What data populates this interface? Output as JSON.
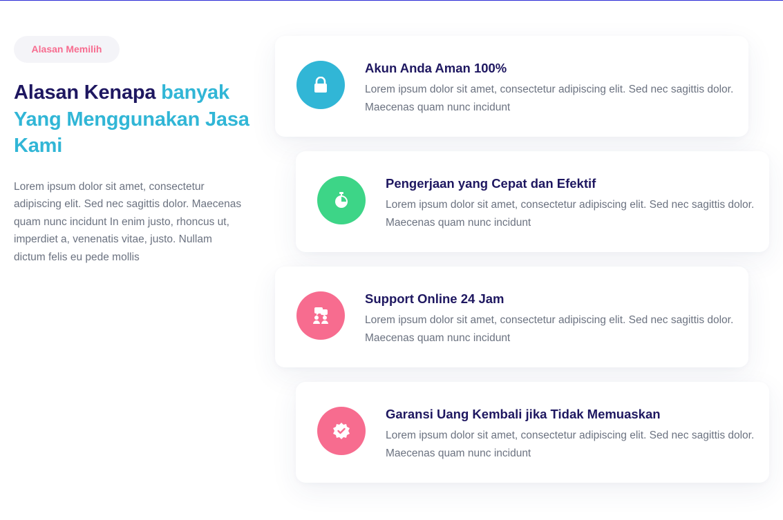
{
  "top_line_color": "#2a2ad6",
  "badge": {
    "label": "Alasan Memilih",
    "color": "#f76c8f"
  },
  "heading": {
    "part1": "Alasan Kenapa ",
    "part2": "banyak Yang Menggunakan Jasa Kami",
    "color_primary": "#1e1760",
    "color_accent": "#31b6d6"
  },
  "description": "Lorem ipsum dolor sit amet, consectetur adipiscing elit. Sed nec sagittis dolor. Maecenas quam nunc incidunt In enim justo, rhoncus ut, imperdiet a, venenatis vitae, justo. Nullam dictum felis eu pede mollis",
  "features": [
    {
      "title": "Akun Anda Aman 100%",
      "text": "Lorem ipsum dolor sit amet, consectetur adipiscing elit. Sed nec sagittis dolor. Maecenas quam nunc incidunt",
      "icon": "lock-icon",
      "icon_color": "#31b6d6"
    },
    {
      "title": "Pengerjaan yang Cepat dan Efektif",
      "text": "Lorem ipsum dolor sit amet, consectetur adipiscing elit. Sed nec sagittis dolor. Maecenas quam nunc incidunt",
      "icon": "stopwatch-icon",
      "icon_color": "#3dd587"
    },
    {
      "title": "Support Online 24 Jam",
      "text": "Lorem ipsum dolor sit amet, consectetur adipiscing elit. Sed nec sagittis dolor. Maecenas quam nunc incidunt",
      "icon": "support-chat-icon",
      "icon_color": "#f76c8f"
    },
    {
      "title": "Garansi Uang Kembali jika Tidak Memuaskan",
      "text": "Lorem ipsum dolor sit amet, consectetur adipiscing elit. Sed nec sagittis dolor. Maecenas quam nunc incidunt",
      "icon": "badge-check-icon",
      "icon_color": "#f76c8f"
    }
  ]
}
